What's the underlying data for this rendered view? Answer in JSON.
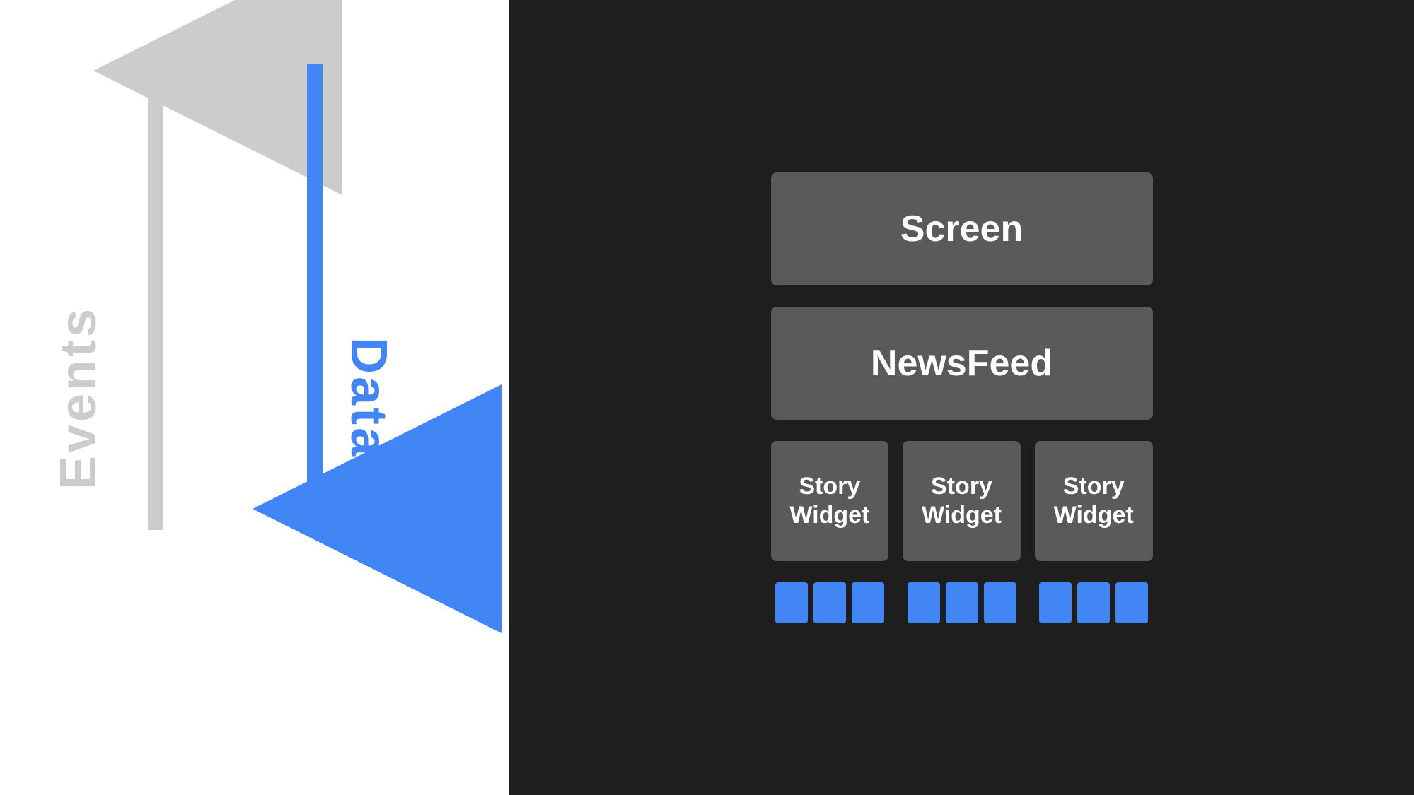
{
  "left": {
    "events_label": "Events",
    "data_label": "Data",
    "background_color": "#ffffff"
  },
  "right": {
    "background_color": "#1e1e1e",
    "screen_label": "Screen",
    "newsfeed_label": "NewsFeed",
    "story_widgets": [
      {
        "label": "Story Widget"
      },
      {
        "label": "Story Widget"
      },
      {
        "label": "Story Widget"
      }
    ],
    "blue_dot_groups": [
      {
        "dots": 3
      },
      {
        "dots": 3
      },
      {
        "dots": 3
      }
    ]
  },
  "colors": {
    "blue": "#4285f4",
    "gray_arrow": "#cccccc",
    "box_bg": "#5a5a5a",
    "dark_bg": "#1e1e1e",
    "white": "#ffffff"
  }
}
